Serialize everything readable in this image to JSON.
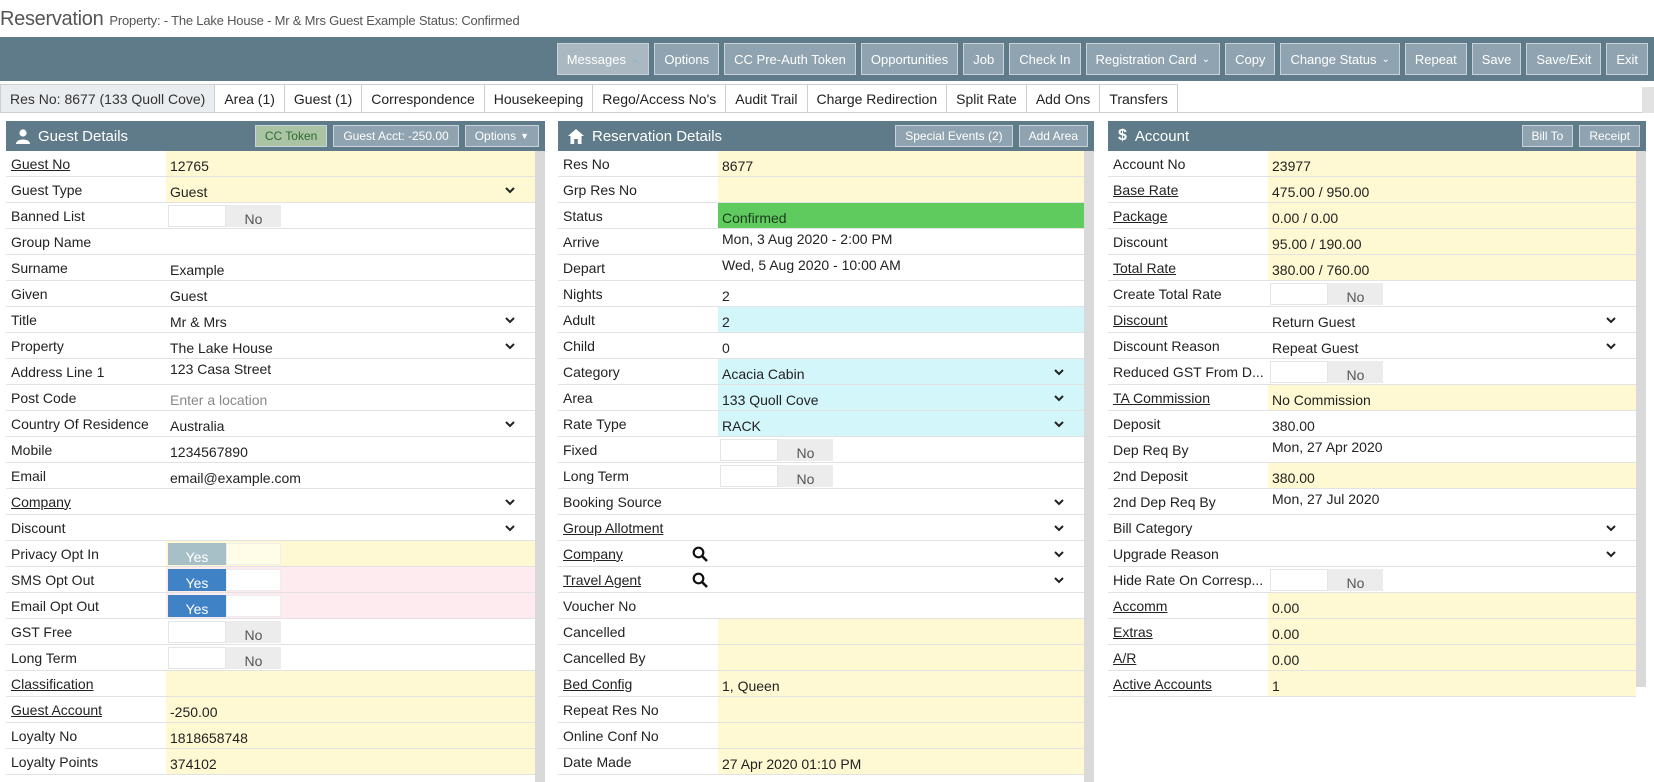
{
  "window": {
    "title": "Reservation",
    "subtitle": "Property: - The Lake House -  Mr & Mrs Guest Example   Status: Confirmed"
  },
  "toolbar": [
    {
      "label": "Messages",
      "caret": true,
      "active": true
    },
    {
      "label": "Options"
    },
    {
      "label": "CC Pre-Auth Token"
    },
    {
      "label": "Opportunities"
    },
    {
      "label": "Job"
    },
    {
      "label": "Check In"
    },
    {
      "label": "Registration Card",
      "caret": true
    },
    {
      "label": "Copy"
    },
    {
      "label": "Change Status",
      "caret": true
    },
    {
      "label": "Repeat"
    },
    {
      "label": "Save"
    },
    {
      "label": "Save/Exit"
    },
    {
      "label": "Exit"
    }
  ],
  "tabs": [
    {
      "label": "Res No: 8677 (133 Quoll Cove)",
      "active": true
    },
    {
      "label": "Area (1)"
    },
    {
      "label": "Guest (1)"
    },
    {
      "label": "Correspondence"
    },
    {
      "label": "Housekeeping"
    },
    {
      "label": "Rego/Access No's"
    },
    {
      "label": "Audit Trail"
    },
    {
      "label": "Charge Redirection"
    },
    {
      "label": "Split Rate"
    },
    {
      "label": "Add Ons"
    },
    {
      "label": "Transfers"
    }
  ],
  "guest": {
    "title": "Guest Details",
    "buttons": {
      "cc_token": "CC Token",
      "guest_acct": "Guest Acct: -250.00",
      "options": "Options"
    },
    "rows": [
      {
        "label": "Guest No",
        "value": "12765",
        "link": true,
        "bg": "yellow"
      },
      {
        "label": "Guest Type",
        "value": "Guest",
        "bg": "yellow",
        "select": true
      },
      {
        "label": "Banned List",
        "toggle": "no"
      },
      {
        "label": "Group Name",
        "value": ""
      },
      {
        "label": "Surname",
        "value": "Example"
      },
      {
        "label": "Given",
        "value": "Guest"
      },
      {
        "label": "Title",
        "value": "Mr & Mrs",
        "select": true
      },
      {
        "label": "Property",
        "value": "The Lake House",
        "select": true
      },
      {
        "label": "Address Line 1",
        "value": "123 Casa Street",
        "top": true
      },
      {
        "label": "Post Code",
        "placeholder": "Enter a location"
      },
      {
        "label": "Country Of Residence",
        "value": "Australia",
        "select": true
      },
      {
        "label": "Mobile",
        "value": "1234567890"
      },
      {
        "label": "Email",
        "value": "email@example.com"
      },
      {
        "label": "Company",
        "value": "",
        "link": true,
        "select": true
      },
      {
        "label": "Discount",
        "value": "",
        "select": true
      },
      {
        "label": "Privacy Opt In",
        "toggle": "yes-grey",
        "bg": "yellow"
      },
      {
        "label": "SMS Opt Out",
        "toggle": "yes-blue",
        "bg": "pink"
      },
      {
        "label": "Email Opt Out",
        "toggle": "yes-blue",
        "bg": "pink"
      },
      {
        "label": "GST Free",
        "toggle": "no"
      },
      {
        "label": "Long Term",
        "toggle": "no"
      },
      {
        "label": "Classification",
        "value": "",
        "link": true,
        "bg": "yellow"
      },
      {
        "label": "Guest Account",
        "value": "-250.00",
        "link": true,
        "bg": "yellow"
      },
      {
        "label": "Loyalty No",
        "value": "1818658748",
        "bg": "yellow"
      },
      {
        "label": "Loyalty Points",
        "value": "374102",
        "bg": "yellow"
      }
    ]
  },
  "reservation": {
    "title": "Reservation Details",
    "buttons": {
      "special_events": "Special Events (2)",
      "add_area": "Add Area"
    },
    "rows": [
      {
        "label": "Res No",
        "value": "8677",
        "bg": "yellow"
      },
      {
        "label": "Grp Res No",
        "value": "",
        "bg": "yellow"
      },
      {
        "label": "Status",
        "value": "Confirmed",
        "bg": "green"
      },
      {
        "label": "Arrive",
        "value": "Mon, 3 Aug 2020 - 2:00 PM",
        "top": true
      },
      {
        "label": "Depart",
        "value": "Wed, 5 Aug 2020 - 10:00 AM",
        "top": true
      },
      {
        "label": "Nights",
        "value": "2"
      },
      {
        "label": "Adult",
        "value": "2",
        "bg": "cyan"
      },
      {
        "label": "Child",
        "value": "0"
      },
      {
        "label": "Category",
        "value": "Acacia Cabin",
        "bg": "cyan",
        "select": true
      },
      {
        "label": "Area",
        "value": "133 Quoll Cove",
        "bg": "cyan",
        "select": true
      },
      {
        "label": "Rate Type",
        "value": "RACK",
        "bg": "cyan",
        "select": true
      },
      {
        "label": "Fixed",
        "toggle": "no"
      },
      {
        "label": "Long Term",
        "toggle": "no"
      },
      {
        "label": "Booking Source",
        "value": "",
        "select": true
      },
      {
        "label": "Group Allotment",
        "value": "",
        "link": true,
        "select": true
      },
      {
        "label": "Company",
        "value": "",
        "link": true,
        "select": true,
        "search": true
      },
      {
        "label": "Travel Agent",
        "value": "",
        "link": true,
        "select": true,
        "search": true
      },
      {
        "label": "Voucher No",
        "value": ""
      },
      {
        "label": "Cancelled",
        "value": "",
        "bg": "yellow"
      },
      {
        "label": "Cancelled By",
        "value": "",
        "bg": "yellow"
      },
      {
        "label": "Bed Config",
        "value": "1, Queen",
        "link": true,
        "bg": "yellow"
      },
      {
        "label": "Repeat Res No",
        "value": "",
        "bg": "yellow"
      },
      {
        "label": "Online Conf No",
        "value": "",
        "bg": "yellow"
      },
      {
        "label": "Date Made",
        "value": "27 Apr 2020 01:10 PM",
        "bg": "yellow"
      }
    ]
  },
  "account": {
    "title": "Account",
    "buttons": {
      "bill_to": "Bill To",
      "receipt": "Receipt"
    },
    "rows": [
      {
        "label": "Account No",
        "value": "23977",
        "bg": "yellow"
      },
      {
        "label": "Base Rate",
        "value": "475.00 / 950.00",
        "link": true,
        "bg": "yellow"
      },
      {
        "label": "Package",
        "value": "0.00 / 0.00",
        "link": true,
        "bg": "yellow"
      },
      {
        "label": "Discount",
        "value": "95.00 / 190.00",
        "bg": "yellow"
      },
      {
        "label": "Total Rate",
        "value": "380.00 / 760.00",
        "link": true,
        "bg": "yellow"
      },
      {
        "label": "Create Total Rate",
        "toggle": "no"
      },
      {
        "label": "Discount",
        "value": "Return Guest",
        "link": true,
        "select": true
      },
      {
        "label": "Discount Reason",
        "value": "Repeat Guest",
        "select": true
      },
      {
        "label": "Reduced GST From D...",
        "toggle": "no"
      },
      {
        "label": "TA Commission",
        "value": "No Commission",
        "link": true,
        "bg": "yellow"
      },
      {
        "label": "Deposit",
        "value": "380.00"
      },
      {
        "label": "Dep Req By",
        "value": "Mon, 27 Apr 2020",
        "top": true
      },
      {
        "label": "2nd Deposit",
        "value": "380.00",
        "bg": "yellow"
      },
      {
        "label": "2nd Dep Req By",
        "value": "Mon, 27 Jul 2020",
        "top": true
      },
      {
        "label": "Bill Category",
        "value": "",
        "select": true
      },
      {
        "label": "Upgrade Reason",
        "value": "",
        "select": true
      },
      {
        "label": "Hide Rate On Corresp...",
        "toggle": "no"
      },
      {
        "label": "Accomm",
        "value": "0.00",
        "link": true,
        "bg": "yellow"
      },
      {
        "label": "Extras",
        "value": "0.00",
        "link": true,
        "bg": "yellow"
      },
      {
        "label": "A/R",
        "value": "0.00",
        "link": true,
        "bg": "yellow"
      },
      {
        "label": "Active Accounts",
        "value": "1",
        "link": true,
        "bg": "yellow"
      }
    ]
  },
  "toggle_text": {
    "yes": "Yes",
    "no": "No"
  }
}
